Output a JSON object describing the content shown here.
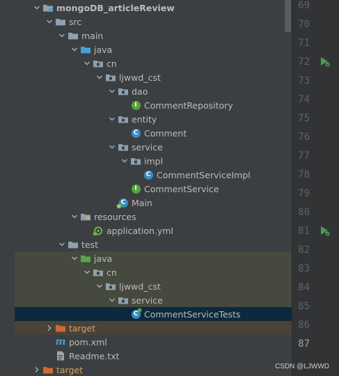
{
  "project_tree": {
    "items": [
      {
        "name": "tree-item-project-root",
        "label": "mongoDB_articleReview",
        "depth": 1,
        "expanded": true,
        "icon": "module-folder-icon",
        "bold": true,
        "bg": ""
      },
      {
        "name": "tree-item-src",
        "label": "src",
        "depth": 2,
        "expanded": true,
        "icon": "folder-icon",
        "bg": ""
      },
      {
        "name": "tree-item-main",
        "label": "main",
        "depth": 3,
        "expanded": true,
        "icon": "folder-icon",
        "bg": ""
      },
      {
        "name": "tree-item-main-java",
        "label": "java",
        "depth": 4,
        "expanded": true,
        "icon": "source-folder-icon",
        "bg": ""
      },
      {
        "name": "tree-item-main-cn",
        "label": "cn",
        "depth": 5,
        "expanded": true,
        "icon": "package-icon",
        "bg": ""
      },
      {
        "name": "tree-item-main-ljwwd-cst",
        "label": "ljwwd_cst",
        "depth": 6,
        "expanded": true,
        "icon": "package-icon",
        "bg": ""
      },
      {
        "name": "tree-item-dao",
        "label": "dao",
        "depth": 7,
        "expanded": true,
        "icon": "package-icon",
        "bg": ""
      },
      {
        "name": "tree-item-comment-repository",
        "label": "CommentRepository",
        "depth": 8,
        "icon": "interface-icon",
        "bg": ""
      },
      {
        "name": "tree-item-entity",
        "label": "entity",
        "depth": 7,
        "expanded": true,
        "icon": "package-icon",
        "bg": ""
      },
      {
        "name": "tree-item-comment",
        "label": "Comment",
        "depth": 8,
        "icon": "class-icon",
        "bg": ""
      },
      {
        "name": "tree-item-service",
        "label": "service",
        "depth": 7,
        "expanded": true,
        "icon": "package-icon",
        "bg": ""
      },
      {
        "name": "tree-item-impl",
        "label": "impl",
        "depth": 8,
        "expanded": true,
        "icon": "package-icon",
        "bg": ""
      },
      {
        "name": "tree-item-comment-service-impl",
        "label": "CommentServiceImpl",
        "depth": 9,
        "icon": "class-icon",
        "bg": ""
      },
      {
        "name": "tree-item-comment-service",
        "label": "CommentService",
        "depth": 8,
        "icon": "interface-icon",
        "bg": ""
      },
      {
        "name": "tree-item-main-class",
        "label": "Main",
        "depth": 7,
        "icon": "spring-class-icon",
        "bg": ""
      },
      {
        "name": "tree-item-resources",
        "label": "resources",
        "depth": 4,
        "expanded": true,
        "icon": "resources-folder-icon",
        "bg": ""
      },
      {
        "name": "tree-item-application-yml",
        "label": "application.yml",
        "depth": 5,
        "icon": "spring-config-icon",
        "bg": ""
      },
      {
        "name": "tree-item-test",
        "label": "test",
        "depth": 3,
        "expanded": true,
        "icon": "folder-icon",
        "bg": ""
      },
      {
        "name": "tree-item-test-java",
        "label": "java",
        "depth": 4,
        "expanded": true,
        "icon": "test-source-folder-icon",
        "bg": "test"
      },
      {
        "name": "tree-item-test-cn",
        "label": "cn",
        "depth": 5,
        "expanded": true,
        "icon": "package-icon",
        "bg": "test"
      },
      {
        "name": "tree-item-test-ljwwd-cst",
        "label": "ljwwd_cst",
        "depth": 6,
        "expanded": true,
        "icon": "package-icon",
        "bg": "test"
      },
      {
        "name": "tree-item-test-service",
        "label": "service",
        "depth": 7,
        "expanded": true,
        "icon": "package-icon",
        "bg": "test"
      },
      {
        "name": "tree-item-comment-service-tests",
        "label": "CommentServiceTests",
        "depth": 8,
        "icon": "test-class-icon",
        "bg": "selected"
      },
      {
        "name": "tree-item-inner-target",
        "label": "target",
        "depth": 2,
        "expanded": false,
        "icon": "excluded-folder-icon",
        "orange": true,
        "bg": "ignored"
      },
      {
        "name": "tree-item-pom-xml",
        "label": "pom.xml",
        "depth": 2,
        "icon": "maven-icon",
        "bg": ""
      },
      {
        "name": "tree-item-readme",
        "label": "Readme.txt",
        "depth": 2,
        "icon": "text-file-icon",
        "bg": ""
      },
      {
        "name": "tree-item-target",
        "label": "target",
        "depth": 1,
        "expanded": false,
        "icon": "excluded-folder-icon",
        "orange": true,
        "bg": ""
      }
    ]
  },
  "gutter": {
    "lines": [
      "69",
      "70",
      "71",
      "72",
      "73",
      "74",
      "75",
      "76",
      "77",
      "78",
      "79",
      "80",
      "81",
      "82",
      "83",
      "84",
      "85",
      "86",
      "87"
    ],
    "current_line": "87",
    "run_markers": [
      "72",
      "81"
    ]
  },
  "colors": {
    "panel_bg": "#3c3f41",
    "editor_bg": "#2b2b2b",
    "selected": "#0d293e",
    "test_highlight": "#45493e",
    "folder": "#8fa0b0",
    "source_folder": "#4a9fd8",
    "test_folder": "#57a64a",
    "excluded_folder": "#d16a32"
  },
  "watermark": "CSDN @LJWWD"
}
